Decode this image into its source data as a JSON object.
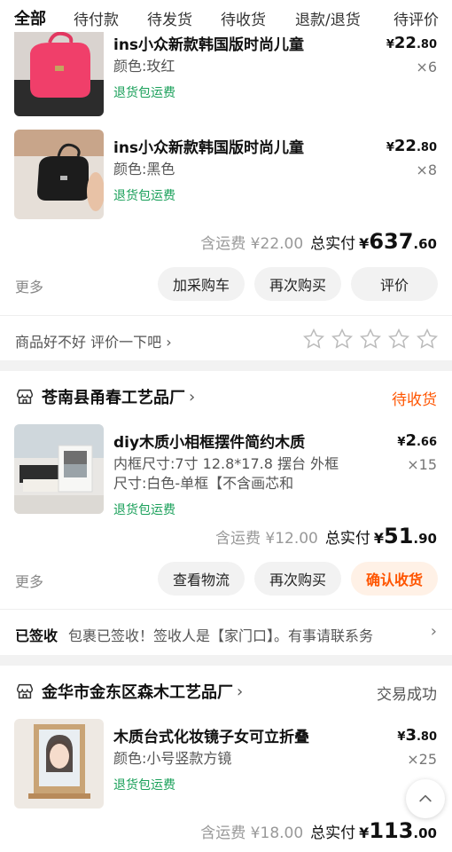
{
  "tabs": [
    "全部",
    "待付款",
    "待发货",
    "待收货",
    "退款/退货",
    "待评价"
  ],
  "order1": {
    "items": [
      {
        "name": "ins小众新款韩国版时尚儿童",
        "spec": "颜色:玫红",
        "return": "退货包运费",
        "price_int": "22",
        "price_dec": ".80",
        "qty": "×6"
      },
      {
        "name": "ins小众新款韩国版时尚儿童",
        "spec": "颜色:黑色",
        "return": "退货包运费",
        "price_int": "22",
        "price_dec": ".80",
        "qty": "×8"
      }
    ],
    "shipping": "含运费 ¥22.00",
    "paid_label": "总实付",
    "currency": "¥",
    "paid_int": "637",
    "paid_dec": ".60",
    "more": "更多",
    "buttons": [
      "加采购车",
      "再次购买",
      "评价"
    ],
    "review_prompt": "商品好不好 评价一下吧",
    "stars": 5
  },
  "order2": {
    "shop": "苍南县甬春工艺品厂",
    "status": "待收货",
    "status_color": "#ff5500",
    "item": {
      "name": "diy木质小相框摆件简约木质",
      "spec": "内框尺寸:7寸 12.8*17.8 摆台 外框尺寸:白色-单框【不含画芯和",
      "return": "退货包运费",
      "price_int": "2",
      "price_dec": ".66",
      "qty": "×15"
    },
    "shipping": "含运费 ¥12.00",
    "paid_label": "总实付",
    "currency": "¥",
    "paid_int": "51",
    "paid_dec": ".90",
    "more": "更多",
    "buttons": [
      "查看物流",
      "再次购买",
      "确认收货"
    ],
    "tracking_status": "已签收",
    "tracking_text": "包裹已签收！签收人是【家门口】。有事请联系务"
  },
  "order3": {
    "shop": "金华市金东区森木工艺品厂",
    "status": "交易成功",
    "status_color": "#555555",
    "item": {
      "name": "木质台式化妆镜子女可立折叠",
      "spec": "颜色:小号竖款方镜",
      "return": "退货包运费",
      "price_int": "3",
      "price_dec": ".80",
      "qty": "×25"
    },
    "shipping": "含运费 ¥18.00",
    "paid_label": "总实付",
    "currency": "¥",
    "paid_int": "113",
    "paid_dec": ".00"
  }
}
